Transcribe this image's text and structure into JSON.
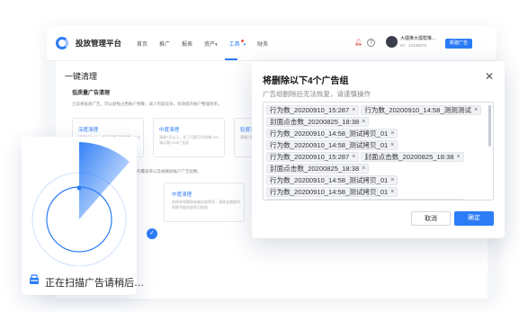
{
  "app": {
    "brand": "投放管理平台",
    "nav": [
      {
        "label": "首页",
        "active": false
      },
      {
        "label": "推广",
        "active": false
      },
      {
        "label": "报表",
        "active": false
      },
      {
        "label": "资产",
        "active": false
      },
      {
        "label": "工具",
        "active": true
      },
      {
        "label": "财务",
        "active": false
      }
    ],
    "user_name": "大疆推大疆帮推...",
    "user_sub": "ID：12345678",
    "new_ad_button": "新建广告",
    "accent": "#2b7cf6"
  },
  "panel": {
    "title": "一键清理",
    "section": "低质量广告清理",
    "tip": "之前将低质广告，可以避免占用账户预算，减少内容竞争，有效提升账户整理效率。",
    "cards": [
      {
        "title": "深度清理",
        "desc": "清理7天以上，花了可是日均消耗<10%展示量<200广告组"
      },
      {
        "title": "中度清理",
        "desc": "清理7天以上，花了可是日均消耗<5%展示量<100广告组"
      },
      {
        "title": "轻度清理",
        "desc": "清理7天以上…"
      }
    ],
    "tip2": "无效投放清理，比较匹配出现，较低的覆盖率以及被删除账户广告组数。",
    "card2": {
      "title": "中度清理",
      "desc": "依照有效删除或者投放频率，清理长期超时前期不能投放的日投放"
    }
  },
  "scan": {
    "text": "正在扫描广告请稍后…"
  },
  "dialog": {
    "title": "将删除以下4个广告组",
    "subtitle": "广告组删除后无法恢复，请谨慎操作",
    "tags": [
      "行为数_20200910_15:287",
      "行为数_20200910_14:58_测测测试",
      "封面点击数_20200825_18:38",
      "行为数_20200910_14:58_测试拷贝_01",
      "行为数_20200910_14:58_测试拷贝_01",
      "行为数_20200910_15:287",
      "封面点击数_20200825_18:38",
      "封面点击数_20200825_18:38",
      "行为数_20200910_14:58_测试拷贝_01",
      "行为数_20200910_14:58_测试拷贝_01",
      "行为数_20200910_15:287",
      "封面点击数_20200825_18:38"
    ],
    "close_icon": "close-icon",
    "cancel_label": "取消",
    "ok_label": "确定"
  }
}
